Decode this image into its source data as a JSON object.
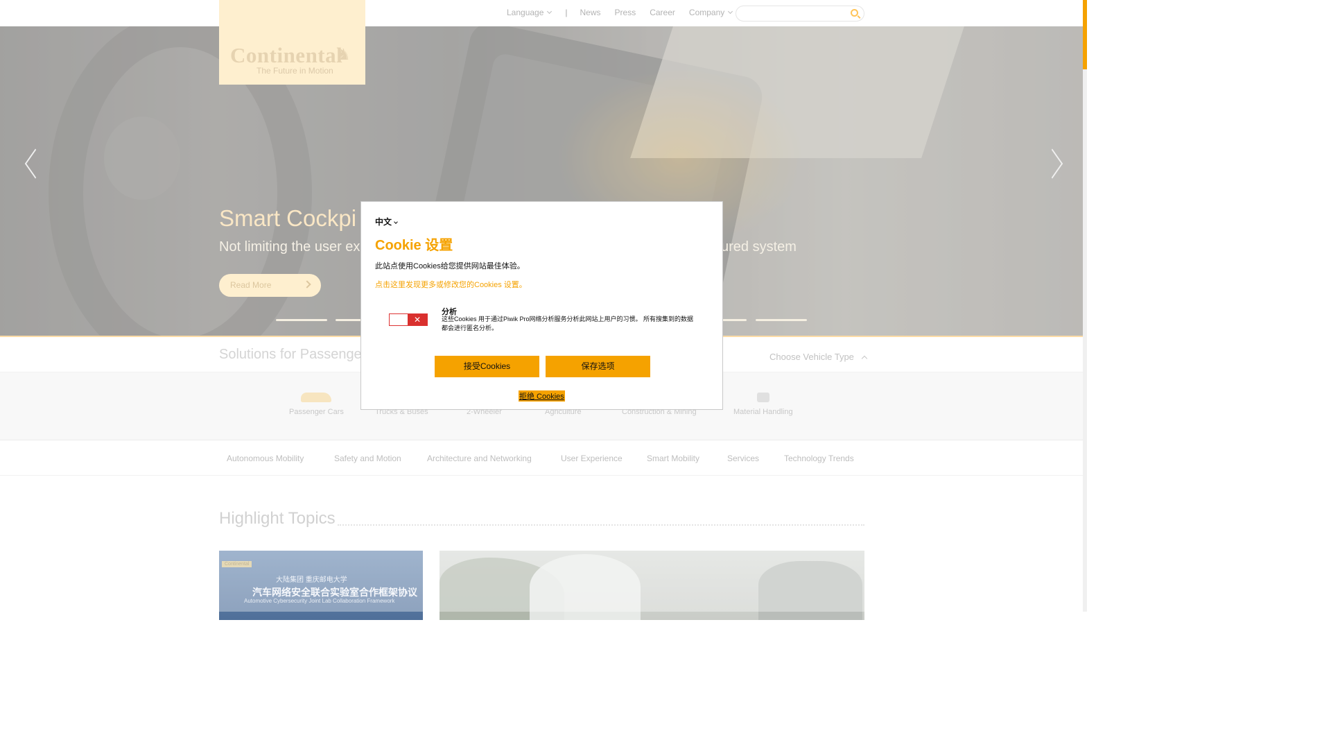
{
  "header": {
    "nav": [
      {
        "label": "Language",
        "has_dropdown": true
      },
      {
        "label": "|",
        "separator": true
      },
      {
        "label": "News"
      },
      {
        "label": "Press"
      },
      {
        "label": "Career"
      },
      {
        "label": "Company",
        "has_dropdown": true
      }
    ],
    "search": {
      "placeholder": "",
      "value": ""
    },
    "logo": {
      "brand": "Continental",
      "tagline": "The Future in Motion"
    }
  },
  "hero": {
    "title": "Smart Cockpi",
    "subtitle": "Not limiting the user ex",
    "subtitle_tail": "ured system",
    "read_more": "Read More",
    "slide_count": 5
  },
  "solutions": {
    "title": "Solutions for Passenger",
    "choose_vehicle_type": "Choose Vehicle Type",
    "vehicles": [
      {
        "label": "Passenger Cars",
        "icon": "car-icon"
      },
      {
        "label": "Trucks & Buses",
        "icon": "truck-icon"
      },
      {
        "label": "2-Wheeler",
        "icon": "motorbike-icon"
      },
      {
        "label": "Agriculture",
        "icon": "tractor-icon"
      },
      {
        "label": "Construction & Mining",
        "icon": "excavator-icon"
      },
      {
        "label": "Material Handling",
        "icon": "forklift-icon"
      }
    ],
    "topics": [
      "Autonomous Mobility",
      "Safety and Motion",
      "Architecture and Networking",
      "User Experience",
      "Smart Mobility",
      "Services",
      "Technology Trends"
    ]
  },
  "highlights": {
    "title": "Highlight Topics",
    "card1": {
      "logo": "Continental",
      "line1": "大陆集团        重庆邮电大学",
      "line2": "汽车网络安全联合实验室合作框架协议",
      "line3": "Automotive Cybersecurity Joint Lab Collaboration Framework"
    }
  },
  "cookie_modal": {
    "language": "中文",
    "title": "Cookie 设置",
    "intro": "此站点使用Cookies给您提供网站最佳体验。",
    "link": "点击这里发现更多或修改您的Cookies 设置。",
    "category_title": "分析",
    "category_desc": "这些Cookies 用于通过Piwik Pro网络分析服务分析此网站上用户的习惯。 所有搜集到的数据都会进行匿名分析。",
    "toggle_state": "off",
    "accept": "接受Cookies",
    "save": "保存选项",
    "reject": "拒绝 Cookies"
  },
  "colors": {
    "accent": "#f5a200",
    "logo_bg": "#fde6b5",
    "toggle_off": "#d9302e"
  }
}
